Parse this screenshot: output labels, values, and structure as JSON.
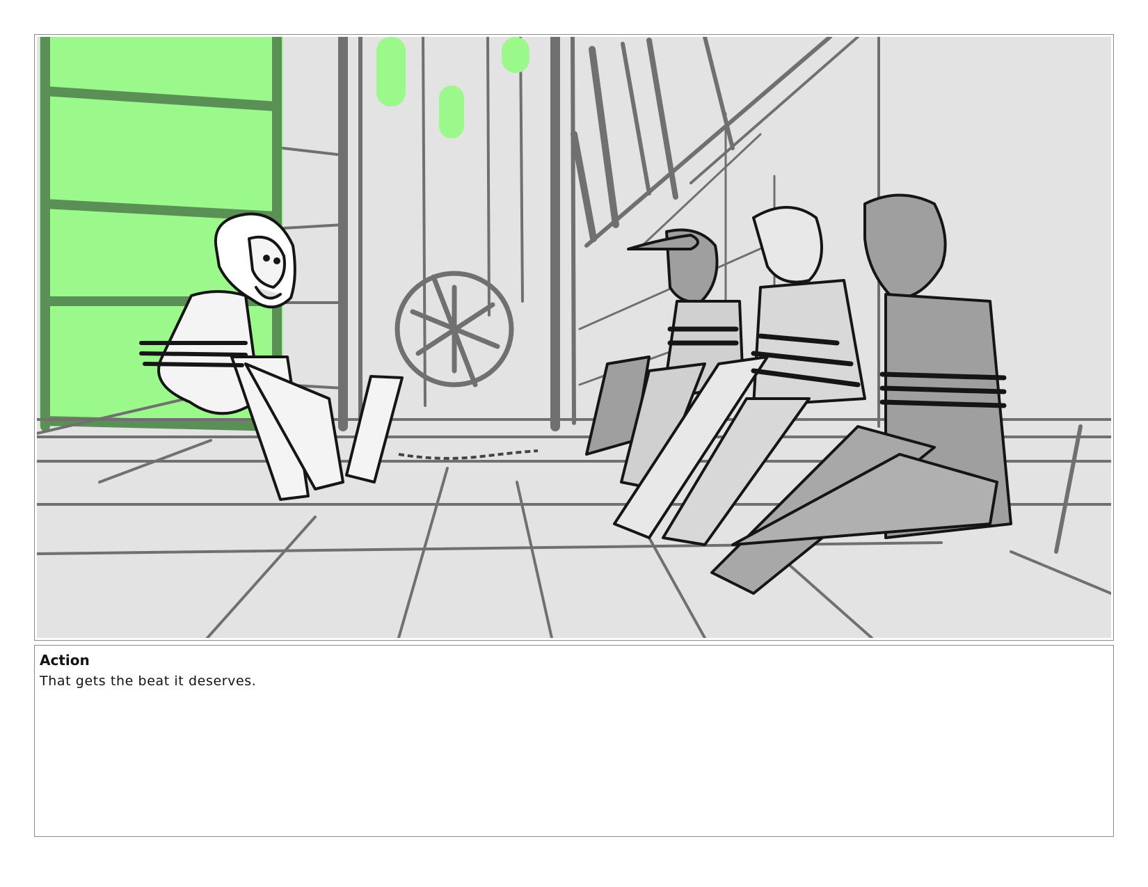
{
  "panel": {
    "scene_colors": {
      "background": "#e3e3e3",
      "accent_green": "#9bf98b",
      "dark_green": "#5a8f55",
      "line_gray": "#707070",
      "ink": "#151515",
      "figure_gray": "#9f9f9f"
    }
  },
  "notes": {
    "heading": "Action",
    "body": "That gets the beat it deserves."
  }
}
